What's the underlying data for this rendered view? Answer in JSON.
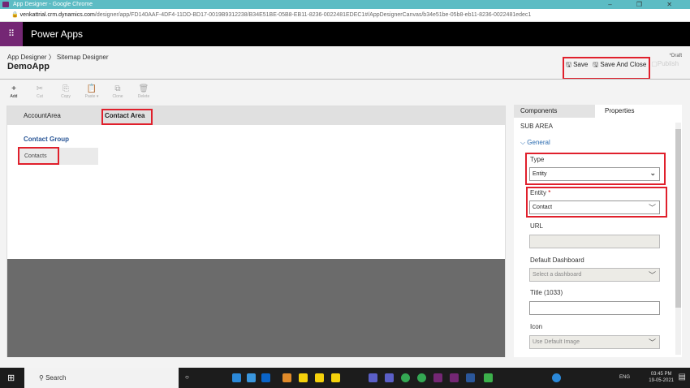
{
  "browser": {
    "title": "App Designer - Google Chrome",
    "url_host": "venkattrial.crm.dynamics.com",
    "url_path": "/designer/app/FD140AAF-4DF4-11DD-BD17-0019B9312238/B34E51BE-05B8-EB11-8236-0022481EDEC1#/AppDesignerCanvas/b34e51be-05b8-eb11-8236-0022481edec1",
    "controls": "–  ❐  ✕"
  },
  "app": {
    "name": "Power Apps"
  },
  "header": {
    "breadcrumb": "App Designer 〉 Sitemap Designer",
    "title": "DemoApp",
    "draft": "*Draft",
    "save": "Save",
    "save_close": "Save And Close",
    "publish": "Publish"
  },
  "toolbar": [
    {
      "icon": "+",
      "label": "Add"
    },
    {
      "icon": "✂",
      "label": "Cut"
    },
    {
      "icon": "⎘",
      "label": "Copy"
    },
    {
      "icon": "📋",
      "label": "Paste ▾"
    },
    {
      "icon": "⧉",
      "label": "Clone"
    },
    {
      "icon": "🗑",
      "label": "Delete"
    }
  ],
  "canvas": {
    "tabs": [
      "AccountArea",
      "Contact Area"
    ],
    "group": "Contact Group",
    "subarea": "Contacts"
  },
  "panel": {
    "tabs": [
      "Components",
      "Properties"
    ],
    "section": "SUB AREA",
    "group": "General",
    "type_label": "Type",
    "type_value": "Entity",
    "entity_label": "Entity",
    "required": "*",
    "entity_value": "Contact",
    "url_label": "URL",
    "dashboard_label": "Default Dashboard",
    "dashboard_placeholder": "Select a dashboard",
    "title_label": "Title (1033)",
    "icon_label": "Icon",
    "icon_value": "Use Default Image"
  },
  "taskbar": {
    "search": "Search",
    "lang": "ENG",
    "time": "03:45 PM",
    "date": "19-05-2021"
  }
}
